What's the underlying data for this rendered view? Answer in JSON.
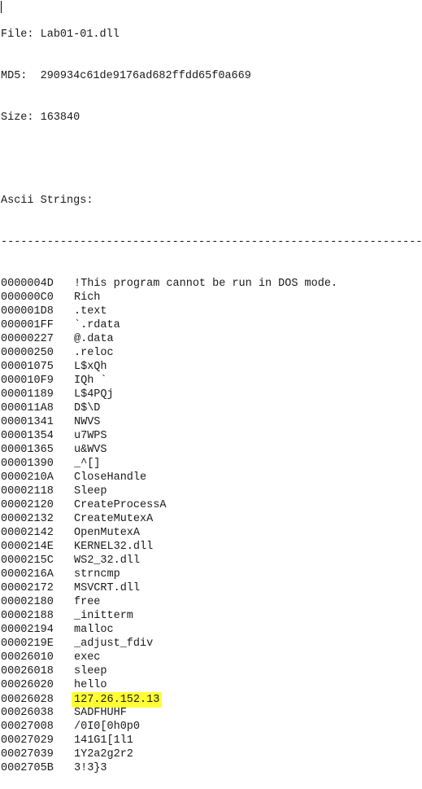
{
  "header": {
    "file_label": "File:",
    "file_name": "Lab01-01.dll",
    "md5_label": "MD5:",
    "md5_value": "290934c61de9176ad682ffdd65f0a669",
    "size_label": "Size:",
    "size_value": "163840"
  },
  "section": {
    "title": "Ascii Strings:",
    "divider": "--------------------------------------------------------------------------"
  },
  "strings": [
    {
      "offset": "0000004D",
      "value": "!This program cannot be run in DOS mode."
    },
    {
      "offset": "000000C0",
      "value": "Rich"
    },
    {
      "offset": "000001D8",
      "value": ".text"
    },
    {
      "offset": "000001FF",
      "value": "`.rdata"
    },
    {
      "offset": "00000227",
      "value": "@.data"
    },
    {
      "offset": "00000250",
      "value": ".reloc"
    },
    {
      "offset": "00001075",
      "value": "L$xQh"
    },
    {
      "offset": "000010F9",
      "value": "IQh `"
    },
    {
      "offset": "00001189",
      "value": "L$4PQj"
    },
    {
      "offset": "000011A8",
      "value": "D$\\D"
    },
    {
      "offset": "00001341",
      "value": "NWVS"
    },
    {
      "offset": "00001354",
      "value": "u7WPS"
    },
    {
      "offset": "00001365",
      "value": "u&WVS"
    },
    {
      "offset": "00001390",
      "value": "_^[]"
    },
    {
      "offset": "0000210A",
      "value": "CloseHandle"
    },
    {
      "offset": "00002118",
      "value": "Sleep"
    },
    {
      "offset": "00002120",
      "value": "CreateProcessA"
    },
    {
      "offset": "00002132",
      "value": "CreateMutexA"
    },
    {
      "offset": "00002142",
      "value": "OpenMutexA"
    },
    {
      "offset": "0000214E",
      "value": "KERNEL32.dll"
    },
    {
      "offset": "0000215C",
      "value": "WS2_32.dll"
    },
    {
      "offset": "0000216A",
      "value": "strncmp"
    },
    {
      "offset": "00002172",
      "value": "MSVCRT.dll"
    },
    {
      "offset": "00002180",
      "value": "free"
    },
    {
      "offset": "00002188",
      "value": "_initterm"
    },
    {
      "offset": "00002194",
      "value": "malloc"
    },
    {
      "offset": "0000219E",
      "value": "_adjust_fdiv"
    },
    {
      "offset": "00026010",
      "value": "exec"
    },
    {
      "offset": "00026018",
      "value": "sleep"
    },
    {
      "offset": "00026020",
      "value": "hello"
    },
    {
      "offset": "00026028",
      "value": "127.26.152.13",
      "highlighted": true
    },
    {
      "offset": "00026038",
      "value": "SADFHUHF"
    },
    {
      "offset": "00027008",
      "value": "/0I0[0h0p0"
    },
    {
      "offset": "00027029",
      "value": "141G1[1l1"
    },
    {
      "offset": "00027039",
      "value": "1Y2a2g2r2"
    },
    {
      "offset": "0002705B",
      "value": "3!3}3"
    }
  ],
  "colors": {
    "highlight": "#ffff33",
    "text": "#1a1a1a"
  }
}
